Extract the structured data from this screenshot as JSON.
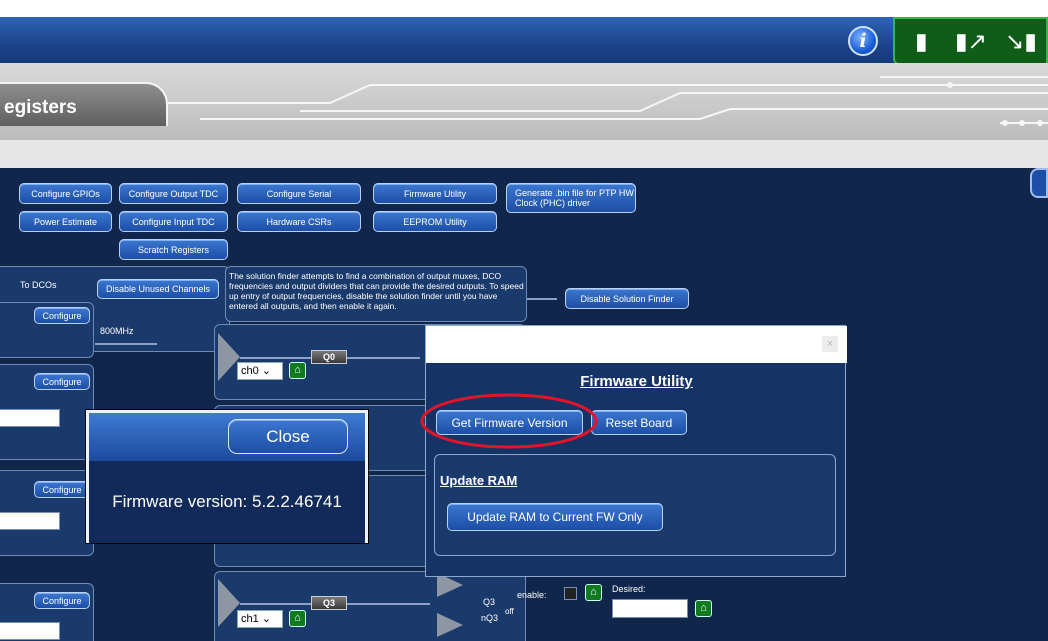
{
  "tab_title": "egisters",
  "info_icon": "i",
  "top_right_icons": [
    "chip-icon",
    "chip-arrow-out-icon",
    "chip-arrow-in-icon"
  ],
  "toolbar": {
    "configure_gpios": "Configure GPIOs",
    "configure_output_tdc": "Configure Output TDC",
    "configure_serial": "Configure Serial",
    "firmware_utility": "Firmware Utility",
    "generate_bin": "Generate .bin file for PTP HW Clock (PHC) driver",
    "power_estimate": "Power Estimate",
    "configure_input_tdc": "Configure Input TDC",
    "hardware_csrs": "Hardware CSRs",
    "eeprom_utility": "EEPROM Utility",
    "scratch_registers": "Scratch Registers"
  },
  "dco": {
    "to_dcos": "To DCOs",
    "disable_unused": "Disable Unused Channels",
    "configure": "Configure",
    "freq_label": "800MHz"
  },
  "solution_finder": {
    "description": "The solution finder attempts to find a combination of output muxes, DCO frequencies and output dividers that can provide the desired outputs. To speed up entry of output frequencies, disable the solution finder until you have entered all outputs, and then enable it again.",
    "button": "Disable Solution Finder"
  },
  "outputs": [
    {
      "channel": "ch0",
      "label": "Q0"
    },
    {
      "channel": "ch1",
      "label": "Q3",
      "pos": "Q3",
      "neg": "nQ3",
      "state": "off",
      "enable_label": "enable:",
      "desired_label": "Desired:"
    }
  ],
  "firmware_dialog": {
    "close_x": "×",
    "title": "Firmware Utility",
    "get_version": "Get Firmware Version",
    "reset_board": "Reset Board",
    "update_ram_heading": "Update RAM",
    "update_ram_button": "Update RAM to Current FW Only"
  },
  "version_popup": {
    "close": "Close",
    "message": "Firmware version: 5.2.2.46741"
  },
  "colors": {
    "highlight_ring": "#e0152a",
    "background": "#10264b",
    "accent": "#2f65b4"
  }
}
